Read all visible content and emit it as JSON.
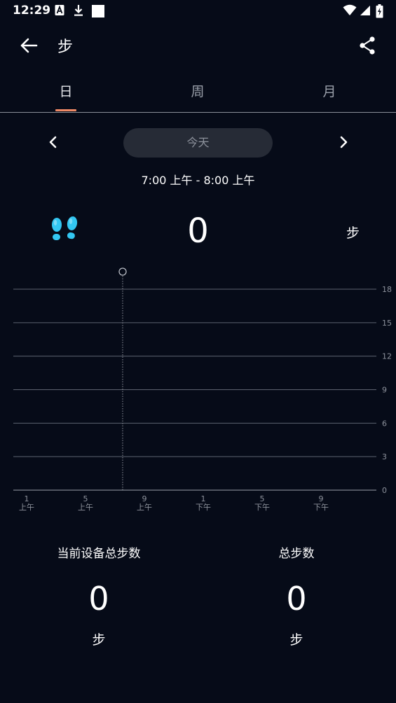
{
  "status_bar": {
    "time": "12:29",
    "icons": [
      "notification-a-icon",
      "download-icon",
      "square-icon",
      "wifi-icon",
      "signal-icon",
      "battery-icon"
    ]
  },
  "app_bar": {
    "title": "步",
    "icons": [
      "back-arrow-icon",
      "share-icon"
    ]
  },
  "tabs": [
    {
      "label": "日",
      "active": true
    },
    {
      "label": "周",
      "active": false
    },
    {
      "label": "月",
      "active": false
    }
  ],
  "date_nav": {
    "label": "今天",
    "time_range": "7:00 上午 - 8:00 上午"
  },
  "summary": {
    "value": "0",
    "unit": "步"
  },
  "colors": {
    "background": "#060b18",
    "tab_indicator": "#f08a66",
    "footprint": "#33c7f2",
    "gridline": "#5e6370"
  },
  "chart_data": {
    "type": "bar",
    "y_ticks": [
      0,
      3,
      6,
      9,
      12,
      15,
      18
    ],
    "ylim": [
      0,
      18
    ],
    "x_ticks": [
      {
        "hour": 1,
        "num": "1",
        "period": "上午"
      },
      {
        "hour": 5,
        "num": "5",
        "period": "上午"
      },
      {
        "hour": 9,
        "num": "9",
        "period": "上午"
      },
      {
        "hour": 13,
        "num": "1",
        "period": "下午"
      },
      {
        "hour": 17,
        "num": "5",
        "period": "下午"
      },
      {
        "hour": 21,
        "num": "9",
        "period": "下午"
      }
    ],
    "selected_hour": 7.5,
    "values": [],
    "grid": true
  },
  "stats": {
    "device_total": {
      "label": "当前设备总步数",
      "value": "0",
      "unit": "步"
    },
    "total": {
      "label": "总步数",
      "value": "0",
      "unit": "步"
    }
  }
}
